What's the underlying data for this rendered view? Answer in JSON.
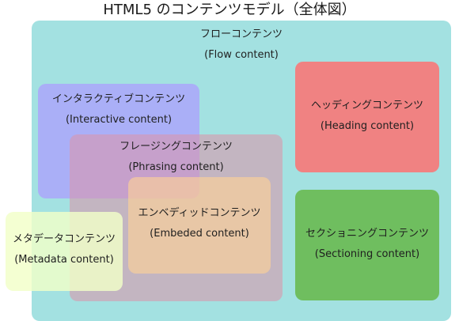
{
  "title": "HTML5 のコンテンツモデル（全体図）",
  "categories": {
    "flow": {
      "ja": "フローコンテンツ",
      "en": "(Flow content)",
      "color": "#a3e1e1"
    },
    "interactive": {
      "ja": "インタラクティブコンテンツ",
      "en": "(Interactive content)",
      "color": "#aaaaf8"
    },
    "phrasing": {
      "ja": "フレージングコンテンツ",
      "en": "(Phrasing content)",
      "color": "#da96aa"
    },
    "embedded": {
      "ja": "エンベディッドコンテンツ",
      "en": "(Embeded content)",
      "color": "#ffd296"
    },
    "metadata": {
      "ja": "メタデータコンテンツ",
      "en": "(Metadata content)",
      "color": "#f2ffc8"
    },
    "heading": {
      "ja": "ヘッディングコンテンツ",
      "en": "(Heading content)",
      "color": "#f08282"
    },
    "sectioning": {
      "ja": "セクショニングコンテンツ",
      "en": "(Sectioning content)",
      "color": "#6fbe5f"
    }
  }
}
